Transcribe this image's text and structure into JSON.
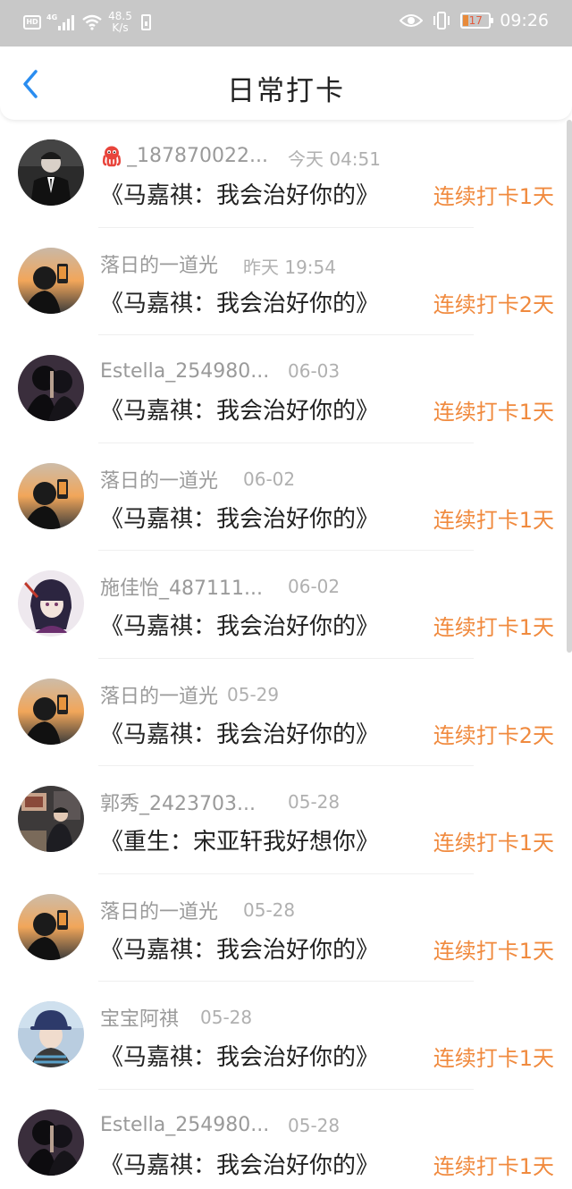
{
  "status_bar": {
    "hd": "HD",
    "network": "4G",
    "speed_value": "48.5",
    "speed_unit": "K/s",
    "battery_level": "17",
    "time": "09:26"
  },
  "header": {
    "title": "日常打卡",
    "back_icon": "chevron-left-icon"
  },
  "colors": {
    "accent_blue": "#2a8df0",
    "streak_orange": "#f08a3e",
    "meta_gray": "#9a9a9a",
    "status_bar_bg": "#c8c8c8"
  },
  "checkins": [
    {
      "username": "_187870022...",
      "user_icon": "octopus-icon",
      "time": "今天 04:51",
      "title": "《马嘉祺：我会治好你的》",
      "streak": "连续打卡1天"
    },
    {
      "username": "落日的一道光",
      "time": "昨天 19:54",
      "title": "《马嘉祺：我会治好你的》",
      "streak": "连续打卡2天"
    },
    {
      "username": "Estella_254980...",
      "time": "06-03",
      "title": "《马嘉祺：我会治好你的》",
      "streak": "连续打卡1天"
    },
    {
      "username": "落日的一道光",
      "time": "06-02",
      "title": "《马嘉祺：我会治好你的》",
      "streak": "连续打卡1天"
    },
    {
      "username": "施佳怡_487111...",
      "time": "06-02",
      "title": "《马嘉祺：我会治好你的》",
      "streak": "连续打卡1天"
    },
    {
      "username": "落日的一道光",
      "time": "05-29",
      "title": "《马嘉祺：我会治好你的》",
      "streak": "连续打卡2天"
    },
    {
      "username": "郭秀_2423703...",
      "time": "05-28",
      "title": "《重生：宋亚轩我好想你》",
      "streak": "连续打卡1天"
    },
    {
      "username": "落日的一道光",
      "time": "05-28",
      "title": "《马嘉祺：我会治好你的》",
      "streak": "连续打卡1天"
    },
    {
      "username": "宝宝阿祺",
      "time": "05-28",
      "title": "《马嘉祺：我会治好你的》",
      "streak": "连续打卡1天"
    },
    {
      "username": "Estella_254980...",
      "time": "05-28",
      "title": "《马嘉祺：我会治好你的》",
      "streak": "连续打卡1天"
    }
  ]
}
